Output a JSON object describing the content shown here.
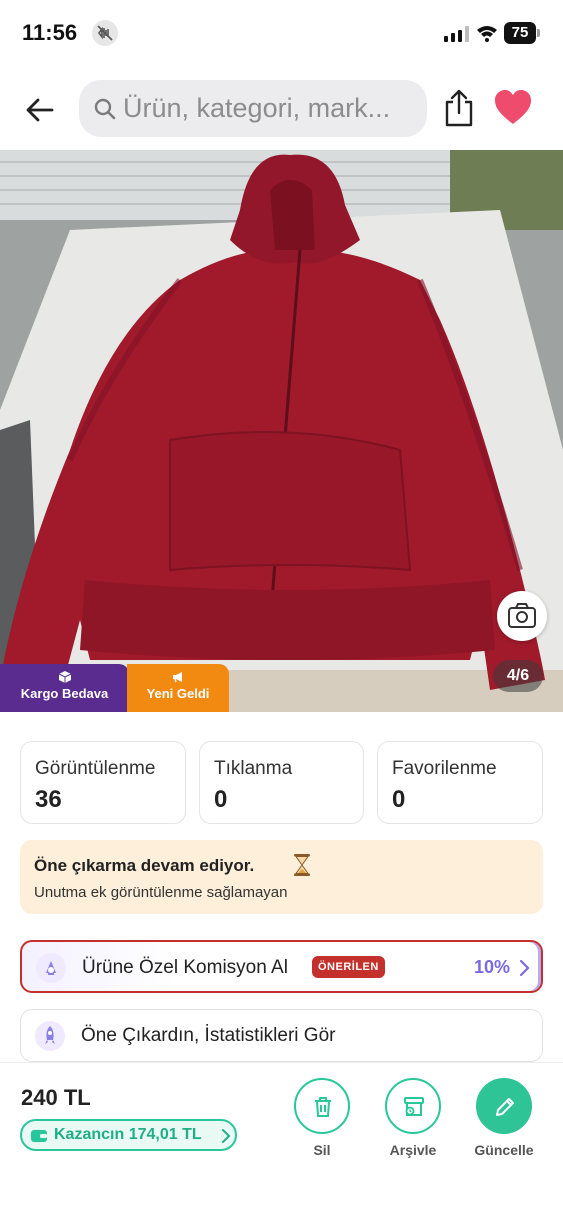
{
  "status_bar": {
    "time": "11:56",
    "battery": "75"
  },
  "header": {
    "search_placeholder": "Ürün, kategori, mark..."
  },
  "product": {
    "image_counter": "4/6",
    "badges": {
      "kargo": "Kargo Bedava",
      "yeni": "Yeni Geldi"
    },
    "colors": {
      "kargo": "#5b2c8f",
      "yeni": "#f28a12",
      "garment": "#a01a2b"
    }
  },
  "stats": [
    {
      "label": "Görüntülenme",
      "value": "36"
    },
    {
      "label": "Tıklanma",
      "value": "0"
    },
    {
      "label": "Favorilenme",
      "value": "0"
    }
  ],
  "promo": {
    "title": "Öne çıkarma devam ediyor.",
    "subtitle": "Unutma ek görüntülenme sağlamayan"
  },
  "actions": {
    "komisyon": {
      "label": "Ürüne Özel Komisyon Al",
      "badge": "ÖNERİLEN",
      "percent": "10%"
    },
    "istatistik": {
      "label": "Öne Çıkardın, İstatistikleri Gör"
    }
  },
  "bottom": {
    "price": "240 TL",
    "earn": "Kazancın 174,01 TL",
    "buttons": {
      "delete": "Sil",
      "archive": "Arşivle",
      "update": "Güncelle"
    },
    "accent": "#2ec495"
  }
}
